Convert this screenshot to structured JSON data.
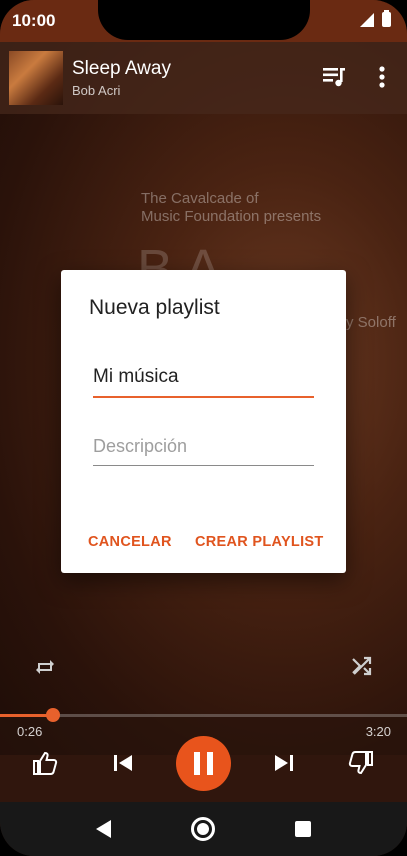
{
  "status_bar": {
    "time": "10:00"
  },
  "now_playing": {
    "title": "Sleep Away",
    "artist": "Bob Acri"
  },
  "album_art": {
    "line1": "The Cavalcade of",
    "line2": "Music Foundation presents",
    "big_text": "B  A",
    "side_text": "y Soloff"
  },
  "dialog": {
    "title": "Nueva playlist",
    "name_value": "Mi música",
    "description_placeholder": "Descripción",
    "cancel_label": "CANCELAR",
    "create_label": "CREAR PLAYLIST"
  },
  "player": {
    "elapsed": "0:26",
    "total": "3:20",
    "progress_fraction": 0.13
  },
  "colors": {
    "accent": "#e8541c",
    "statusbar": "#6a2a12"
  }
}
